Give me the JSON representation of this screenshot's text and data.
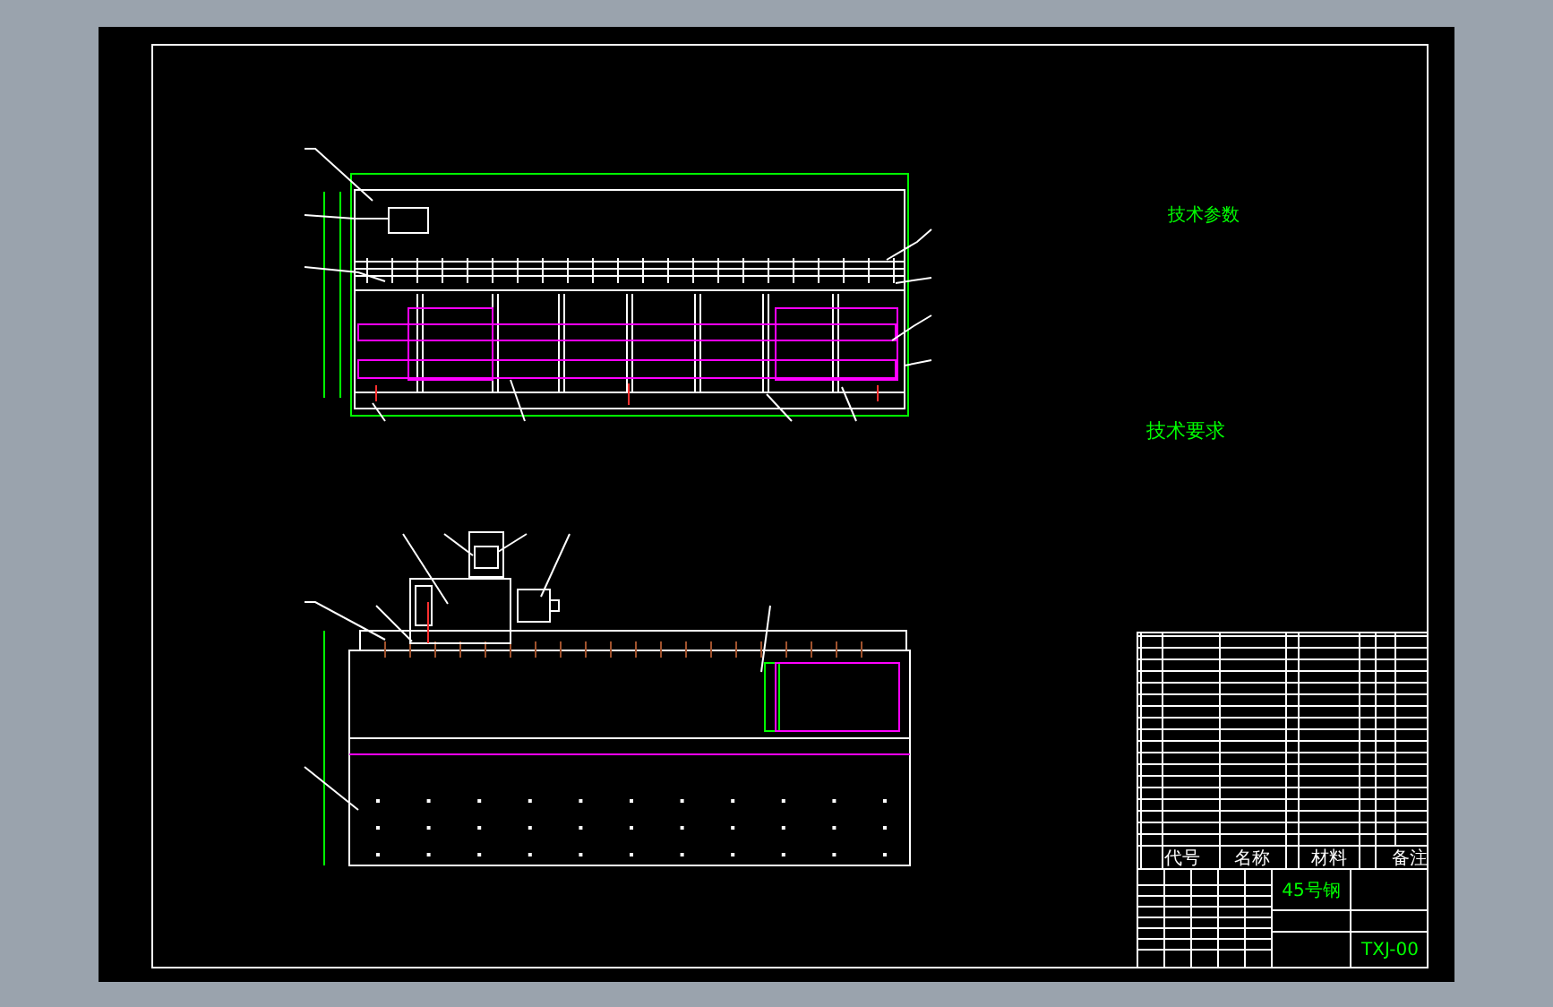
{
  "drawing": {
    "parameters_heading": "技术参数",
    "notes_heading": "技术要求"
  },
  "parts_list": {
    "columns": [
      "代号",
      "名称",
      "材料",
      "备注"
    ]
  },
  "title_block": {
    "material": "45号钢",
    "drawing_number": "TXJ-00"
  }
}
